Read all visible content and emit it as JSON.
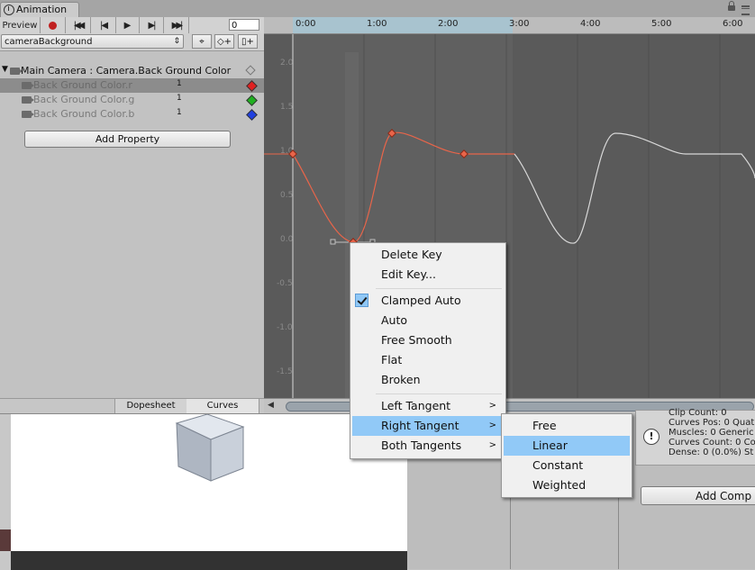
{
  "window": {
    "tab_title": "Animation"
  },
  "toolbar": {
    "preview_label": "Preview",
    "frame_value": "0"
  },
  "clip_selector": {
    "value": "cameraBackground"
  },
  "properties": {
    "parent_label": "Main Camera : Camera.Back Ground Color",
    "items": [
      {
        "label": "Back Ground Color.r",
        "value": "1",
        "color": "#e02020"
      },
      {
        "label": "Back Ground Color.g",
        "value": "1",
        "color": "#20b020"
      },
      {
        "label": "Back Ground Color.b",
        "value": "1",
        "color": "#2040e0"
      }
    ],
    "add_property_label": "Add Property"
  },
  "bottom_tabs": {
    "dopesheet": "Dopesheet",
    "curves": "Curves"
  },
  "timeline": {
    "labels": [
      "0:00",
      "1:00",
      "2:00",
      "3:00",
      "4:00",
      "5:00",
      "6:00"
    ]
  },
  "y_axis": {
    "labels": [
      "2.0",
      "1.5",
      "1.0",
      "0.5",
      "0.0",
      "-0.5",
      "-1.0",
      "-1.5"
    ]
  },
  "context_menu": {
    "delete_key": "Delete Key",
    "edit_key": "Edit Key...",
    "clamped_auto": "Clamped Auto",
    "auto": "Auto",
    "free_smooth": "Free Smooth",
    "flat": "Flat",
    "broken": "Broken",
    "left_tangent": "Left Tangent",
    "right_tangent": "Right Tangent",
    "both_tangents": "Both Tangents"
  },
  "submenu": {
    "free": "Free",
    "linear": "Linear",
    "constant": "Constant",
    "weighted": "Weighted"
  },
  "inspector": {
    "info_lines": [
      "Clip Count: 0",
      "Curves Pos: 0 Quat",
      "Muscles: 0 Generic",
      "Curves Count: 0 Co",
      "Dense: 0 (0.0%) St"
    ],
    "add_component_label": "Add Comp"
  },
  "colors": {
    "curve_selected": "#e8654a",
    "curve_other": "#d8d8d8",
    "menu_highlight": "#91c9f7",
    "timeline_highlight": "#a8c3cf"
  }
}
